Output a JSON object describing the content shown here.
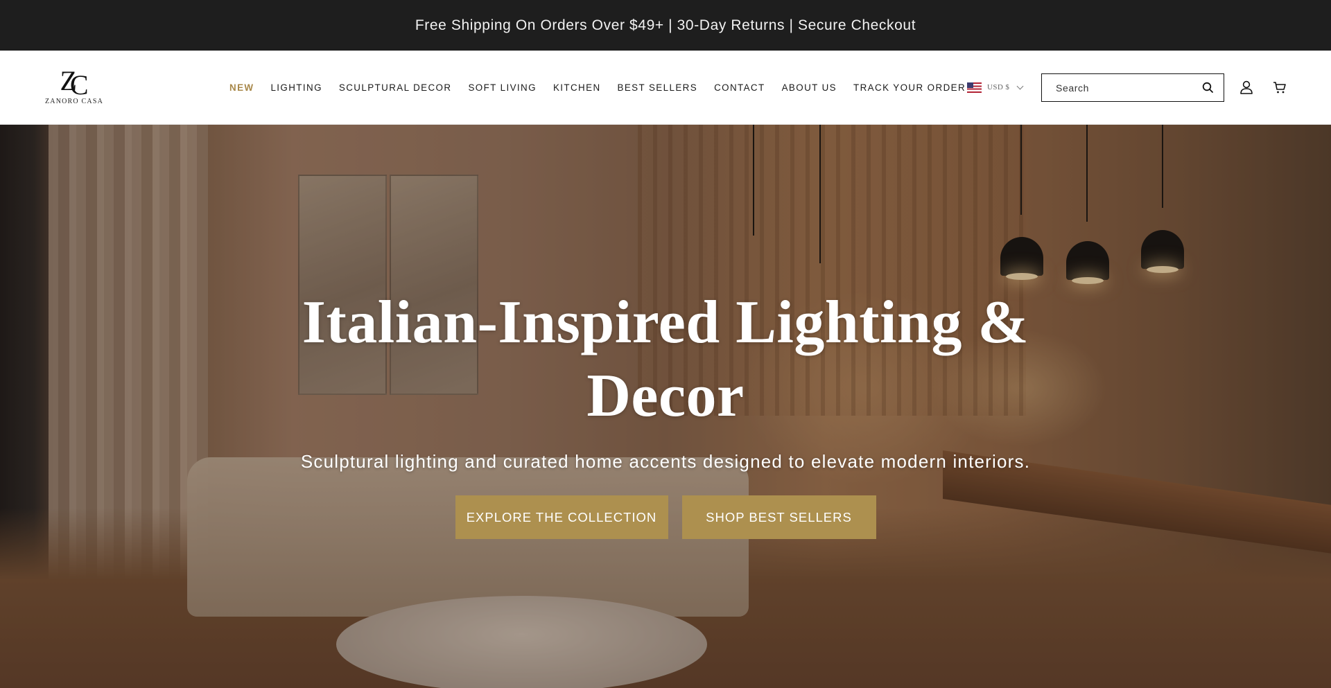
{
  "announcement": {
    "text": "Free Shipping On Orders Over $49+ | 30-Day Returns | Secure Checkout"
  },
  "brand": {
    "monogram_1": "Z",
    "monogram_2": "C",
    "name": "ZANORO CASA"
  },
  "nav": {
    "items": [
      {
        "label": "NEW",
        "active": true
      },
      {
        "label": "LIGHTING",
        "active": false
      },
      {
        "label": "SCULPTURAL DECOR",
        "active": false
      },
      {
        "label": "SOFT LIVING",
        "active": false
      },
      {
        "label": "KITCHEN",
        "active": false
      },
      {
        "label": "BEST SELLERS",
        "active": false
      },
      {
        "label": "CONTACT",
        "active": false
      },
      {
        "label": "ABOUT US",
        "active": false
      },
      {
        "label": "TRACK YOUR ORDER",
        "active": false
      }
    ]
  },
  "currency": {
    "label": "USD $",
    "flag_icon": "us-flag-icon"
  },
  "search": {
    "placeholder": "Search",
    "value": ""
  },
  "header_icons": [
    "search-icon",
    "account-icon",
    "cart-icon"
  ],
  "hero": {
    "title": "Italian-Inspired Lighting & Decor",
    "subtitle": "Sculptural lighting and curated home accents designed to elevate modern interiors.",
    "primary_cta": "EXPLORE THE COLLECTION",
    "secondary_cta": "SHOP BEST SELLERS"
  },
  "colors": {
    "announcement_bg": "#1e1e1e",
    "accent_gold": "#ad904f",
    "nav_active": "#a8884a",
    "header_bg": "#ffffff"
  }
}
